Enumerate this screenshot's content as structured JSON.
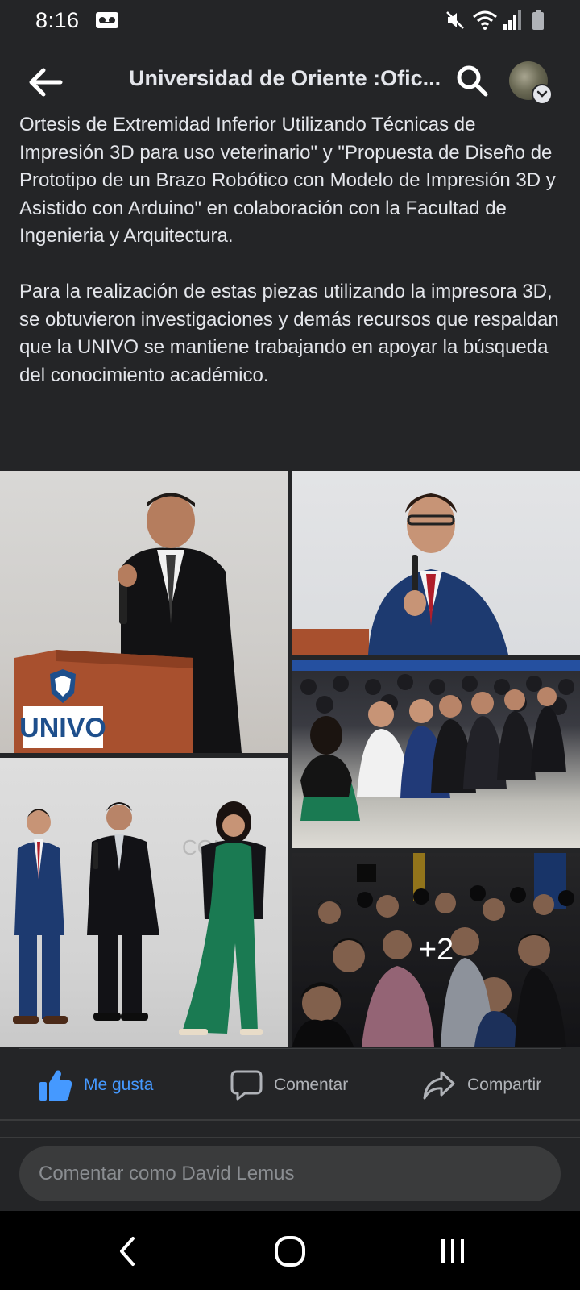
{
  "status_bar": {
    "time": "8:16"
  },
  "header": {
    "title": "Universidad de Oriente :Ofic..."
  },
  "post": {
    "paragraph1": "Ortesis de Extremidad Inferior Utilizando Técnicas de Impresión 3D para uso veterinario\" y \"Propuesta de Diseño de Prototipo de un Brazo Robótico con Modelo de Impresión 3D y Asistido con Arduino\" en colaboración con la Facultad de Ingenieria y Arquitectura.",
    "paragraph2": "Para la realización de estas piezas utilizando la impresora 3D, se obtuvieron investigaciones y demás recursos que respaldan que la UNIVO se mantiene trabajando en apoyar la búsqueda del conocimiento académico.",
    "photos": {
      "podium_logo_text": "UNIVO",
      "more_count": "+2"
    }
  },
  "actions": {
    "like_label": "Me gusta",
    "comment_label": "Comentar",
    "share_label": "Compartir"
  },
  "comment_box": {
    "placeholder": "Comentar como David Lemus"
  },
  "colors": {
    "background": "#242527",
    "text": "#e4e6eb",
    "like_active": "#4599ff",
    "secondary_text": "#b0b3b8",
    "input_bg": "#3a3b3c"
  }
}
